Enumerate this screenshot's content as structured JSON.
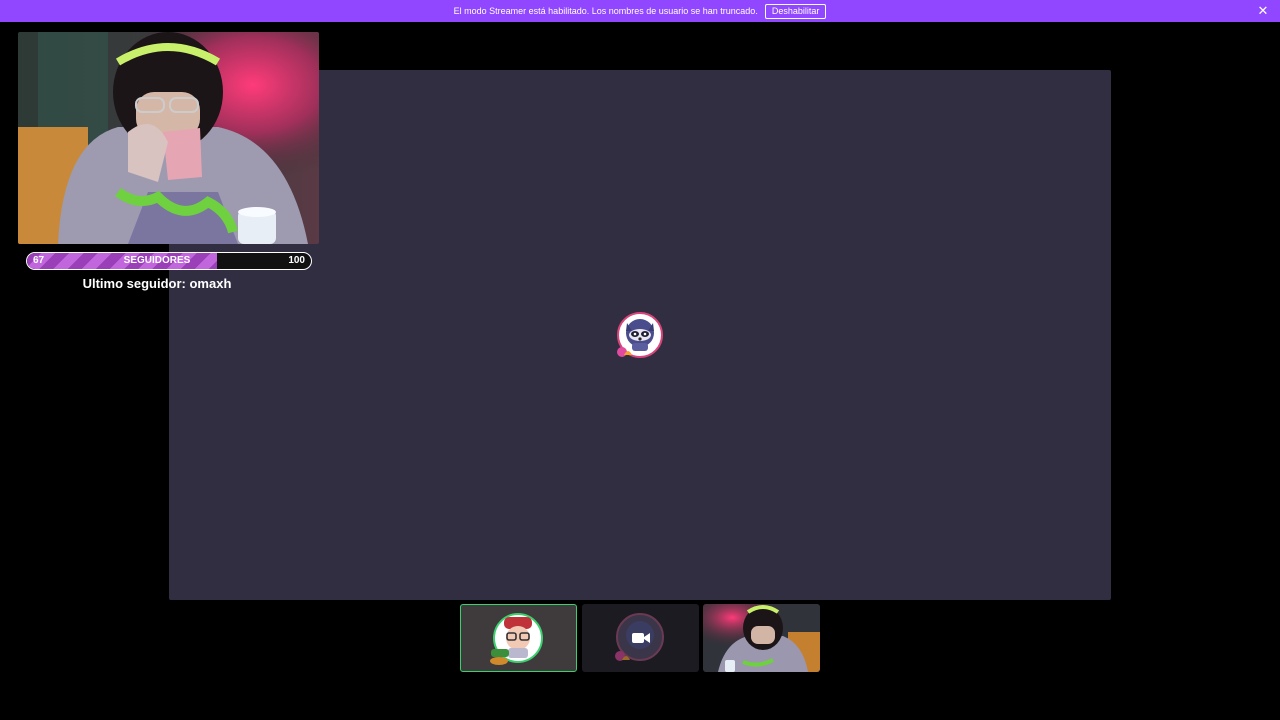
{
  "banner": {
    "message": "El modo Streamer está habilitado. Los nombres de usuario se han truncado.",
    "disable_label": "Deshabilitar",
    "close_icon": "close-icon",
    "color": "#9146ff"
  },
  "overlay": {
    "goal": {
      "current": "67",
      "label": "SEGUIDORES",
      "target": "100",
      "progress_fraction": 0.67
    },
    "last_follower": "Ultimo seguidor: omaxh"
  },
  "stage": {
    "background": "#312e42",
    "avatar_icon": "raccoon-avatar-icon"
  },
  "thumbnails": [
    {
      "icon": "gamer-avatar-icon",
      "selected": true
    },
    {
      "icon": "camera-icon"
    },
    {
      "icon": "webcam-preview"
    }
  ]
}
